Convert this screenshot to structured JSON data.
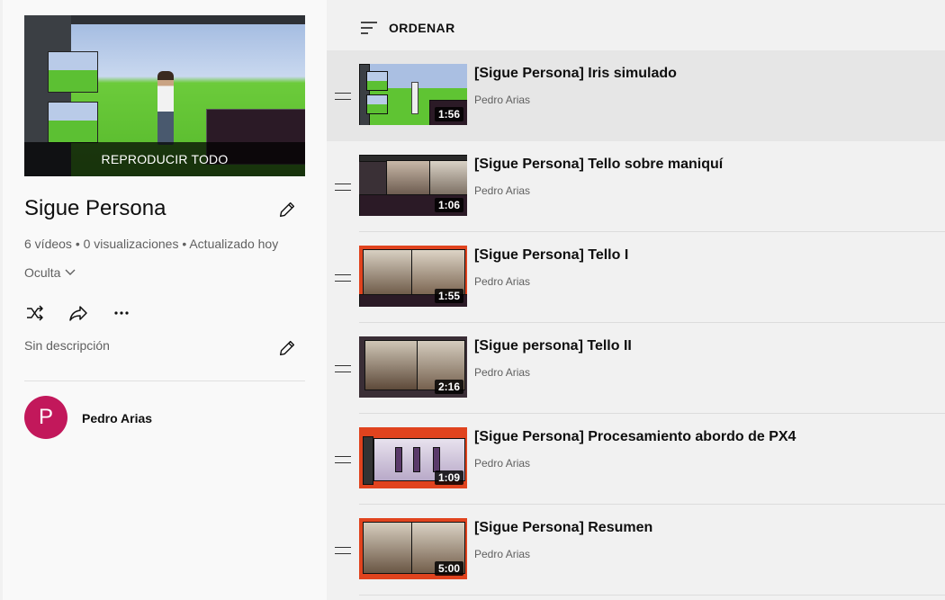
{
  "playlist": {
    "play_all_label": "REPRODUCIR TODO",
    "title": "Sigue Persona",
    "meta": "6 vídeos • 0 visualizaciones • Actualizado hoy",
    "privacy": "Oculta",
    "description": "Sin descripción",
    "owner": {
      "name": "Pedro Arias",
      "initial": "P",
      "avatar_color": "#c2185b"
    },
    "icons": [
      "edit-pencil-icon",
      "shuffle-icon",
      "share-icon",
      "more-icon",
      "chevron-down-icon"
    ]
  },
  "sort": {
    "label": "ORDENAR",
    "icon": "sort-lines-icon"
  },
  "videos": [
    {
      "title": "[Sigue Persona] Iris simulado",
      "channel": "Pedro Arias",
      "duration": "1:56",
      "selected": true
    },
    {
      "title": "[Sigue Persona] Tello sobre maniquí",
      "channel": "Pedro Arias",
      "duration": "1:06"
    },
    {
      "title": "[Sigue Persona] Tello I",
      "channel": "Pedro Arias",
      "duration": "1:55"
    },
    {
      "title": "[Sigue persona] Tello II",
      "channel": "Pedro Arias",
      "duration": "2:16"
    },
    {
      "title": "[Sigue Persona] Procesamiento abordo de PX4",
      "channel": "Pedro Arias",
      "duration": "1:09"
    },
    {
      "title": "[Sigue Persona] Resumen",
      "channel": "Pedro Arias",
      "duration": "5:00"
    }
  ],
  "colors": {
    "accent_red": "#e62117",
    "background": "#f1f1f1",
    "sidebar": "#f9f9f9"
  }
}
